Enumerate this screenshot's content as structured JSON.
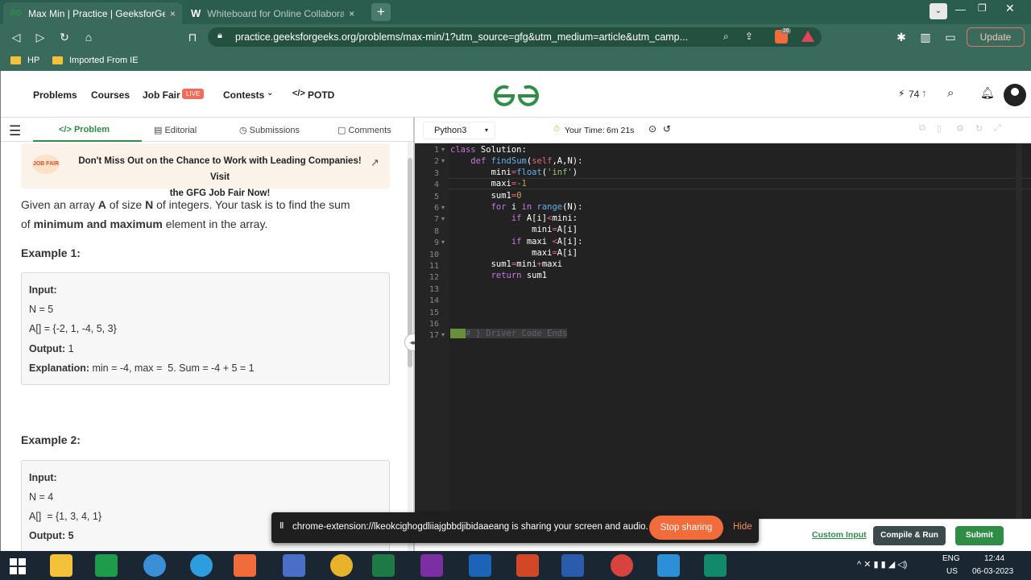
{
  "browser": {
    "tabs": [
      {
        "icon": "gfg-icon",
        "title": "Max Min | Practice | GeeksforGeeks",
        "close": "×"
      },
      {
        "icon": "w-icon",
        "title": "Whiteboard for Online Collaboration |",
        "close": "×"
      }
    ],
    "new_tab": "+",
    "url": "practice.geeksforgeeks.org/problems/max-min/1?utm_source=gfg&utm_medium=article&utm_camp...",
    "update_button": "Update",
    "brave_badge": "26",
    "bookmarks": [
      "HP",
      "Imported From IE"
    ]
  },
  "topnav": {
    "items": [
      "Problems",
      "Courses",
      "Job Fair",
      "Contests",
      "POTD"
    ],
    "live_badge": "LIVE",
    "logo": "GfG",
    "streak": "74"
  },
  "left_tabs": [
    "Problem",
    "Editorial",
    "Submissions",
    "Comments"
  ],
  "banner": {
    "logo_text": "JOB FAIR",
    "line1": "Don't Miss Out on the Chance to Work with Leading Companies! Visit",
    "line2": "the GFG Job Fair Now!"
  },
  "problem": {
    "p1_a": "Given an array ",
    "p1_A": "A",
    "p1_b": " of size ",
    "p1_N": "N",
    "p1_c": " of integers. Your task is to find the sum",
    "p2_a": "of ",
    "p2_b": "minimum and maximum",
    "p2_c": " element in the array."
  },
  "example1": {
    "heading": "Example 1:",
    "input_label": "Input:",
    "n": "N = 5",
    "arr": "A[] = {-2, 1, -4, 5, 3}",
    "output_label": "Output:",
    "output_value": " 1",
    "explanation_label": "Explanation:",
    "explanation_value": " min = -4, max =  5. Sum = -4 + 5 = 1"
  },
  "example2": {
    "heading": "Example 2:",
    "input_label": "Input:",
    "n": "N = 4",
    "arr": "A[]  = {1, 3, 4, 1}",
    "output_label": "Output:",
    "output_value": " 5"
  },
  "editor": {
    "language": "Python3",
    "timer_label": "Your Time:",
    "timer_value": "6m 21s",
    "line_numbers": [
      "1",
      "2",
      "3",
      "4",
      "5",
      "6",
      "7",
      "8",
      "9",
      "10",
      "11",
      "12",
      "13",
      "14",
      "15",
      "16",
      "17"
    ]
  },
  "bottom": {
    "custom_input": "Custom Input",
    "compile_run": "Compile & Run",
    "submit": "Submit"
  },
  "share_notice": {
    "text": "chrome-extension://lkeokcighogdliiajgbbdjibidaaeang is sharing your screen and audio.",
    "stop": "Stop sharing",
    "hide": "Hide"
  },
  "taskbar": {
    "lang": "ENG",
    "region": "US",
    "time": "12:44",
    "date": "06-03-2023"
  },
  "colors": {
    "gfg_green": "#2f8d46",
    "stop_orange": "#f26b3a",
    "tabbar": "#2b5d4f",
    "toolbar": "#3a6a5c"
  }
}
